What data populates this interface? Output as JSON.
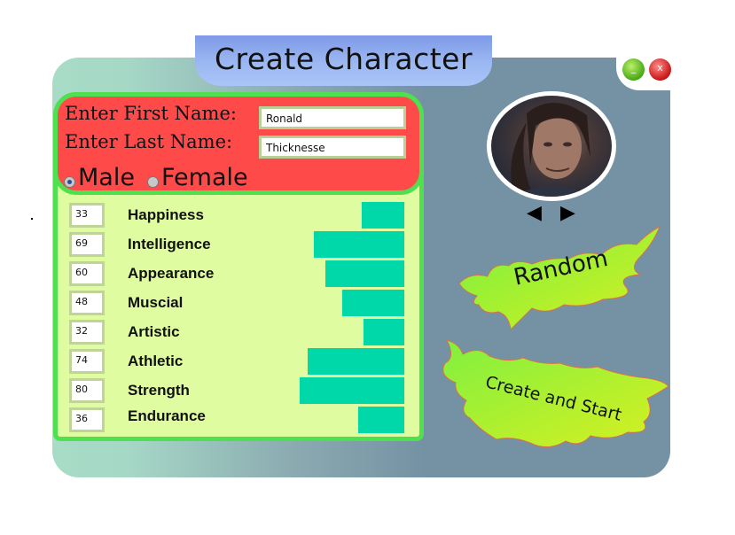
{
  "window": {
    "title": "Create Character",
    "minimize_label": "_",
    "close_label": "x"
  },
  "form": {
    "first_name_label": "Enter First Name:",
    "first_name_value": "Ronald",
    "last_name_label": "Enter Last Name:",
    "last_name_value": "Thicknesse",
    "gender_options": [
      "Male",
      "Female"
    ],
    "gender_selected": "Male"
  },
  "stats": [
    {
      "name": "Happiness",
      "value": "33"
    },
    {
      "name": "Intelligence",
      "value": "69"
    },
    {
      "name": "Appearance",
      "value": "60"
    },
    {
      "name": "Muscial",
      "value": "48"
    },
    {
      "name": "Artistic",
      "value": "32"
    },
    {
      "name": "Athletic",
      "value": "74"
    },
    {
      "name": "Strength",
      "value": "80"
    },
    {
      "name": "Endurance",
      "value": "36"
    }
  ],
  "portrait": {
    "prev_arrow": "◀",
    "next_arrow": "▶"
  },
  "actions": {
    "random_label": "Random",
    "create_label": "Create and Start"
  },
  "colors": {
    "accent_bar": "#00d8aa",
    "splat_fill": "#a8f030",
    "name_box": "#ff4a4a",
    "stat_box": "#e0fca0",
    "border_green": "#4ee04e"
  }
}
